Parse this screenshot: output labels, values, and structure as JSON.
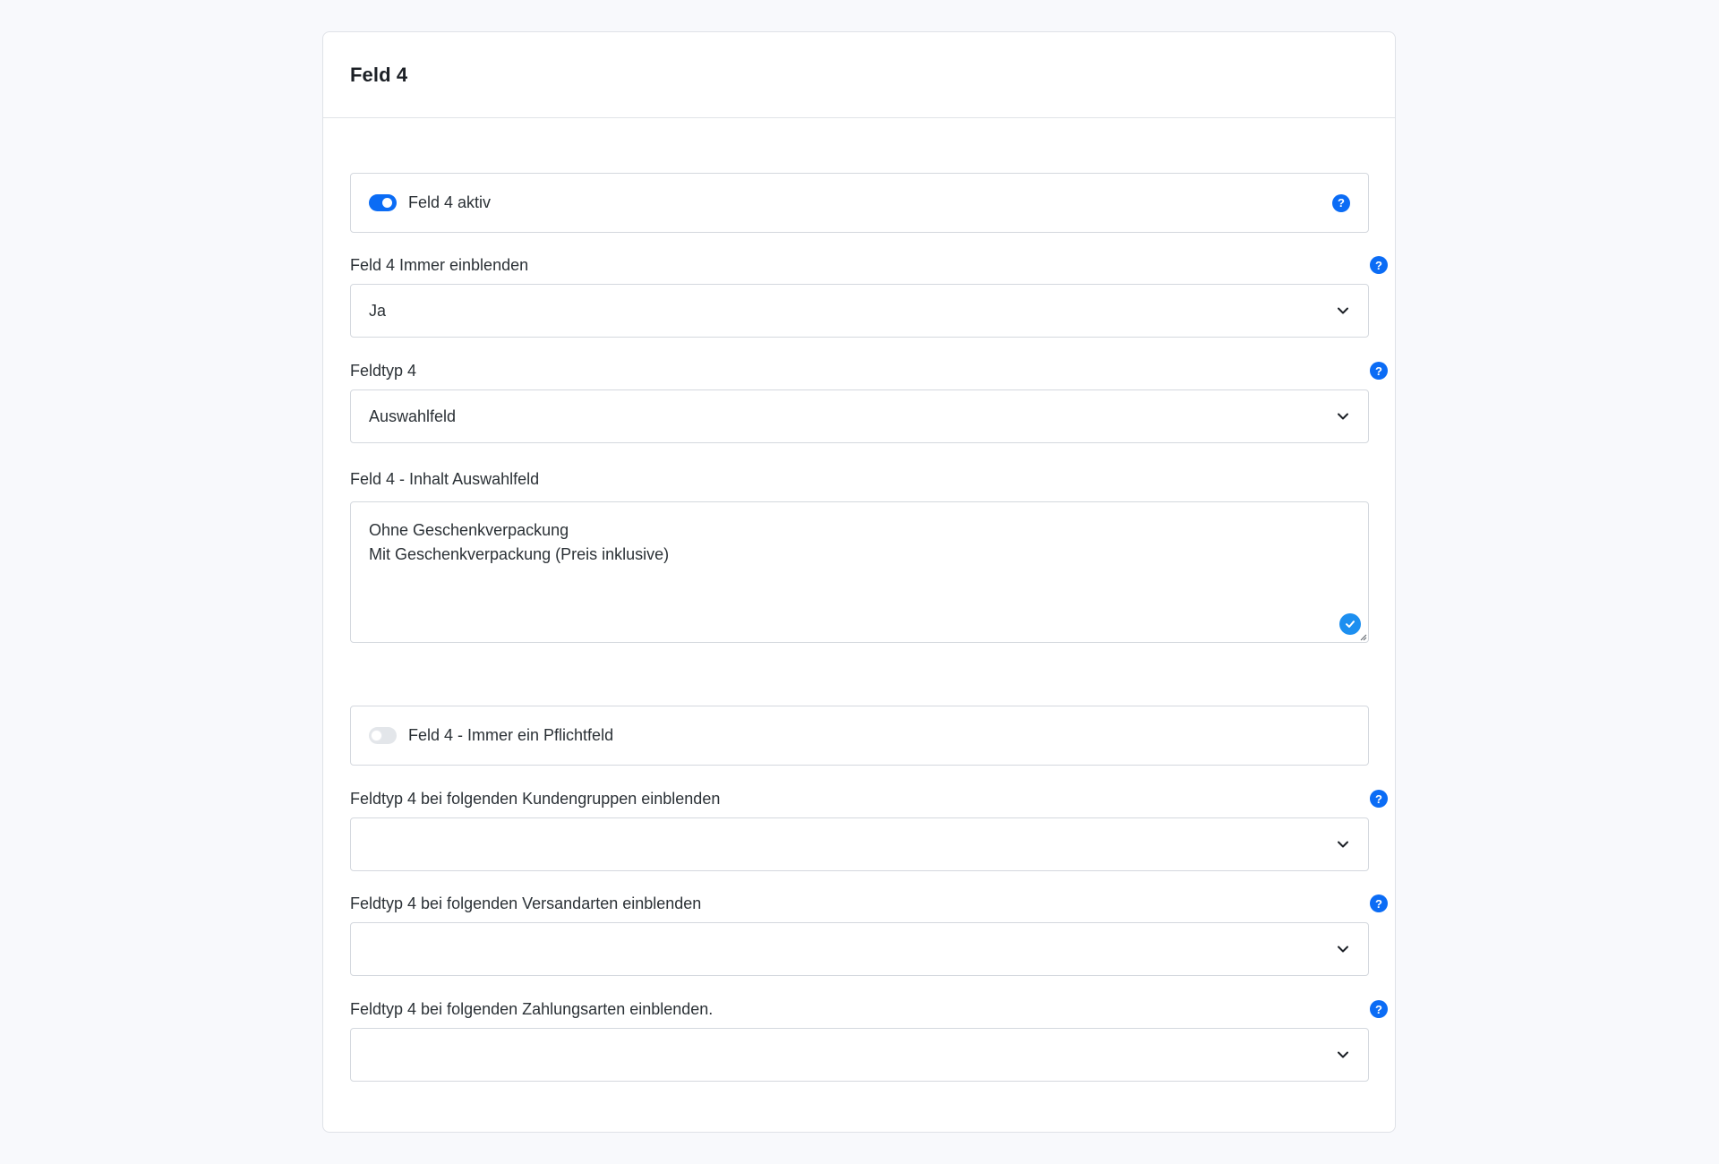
{
  "card": {
    "title": "Feld 4"
  },
  "fields": {
    "active_toggle": {
      "label": "Feld 4 aktiv",
      "checked": true
    },
    "always_show": {
      "label": "Feld 4 Immer einblenden",
      "value": "Ja"
    },
    "field_type": {
      "label": "Feldtyp 4",
      "value": "Auswahlfeld"
    },
    "select_content": {
      "label": "Feld 4 - Inhalt Auswahlfeld",
      "lines": [
        "Ohne Geschenkverpackung",
        "Mit Geschenkverpackung (Preis inklusive)"
      ]
    },
    "required_toggle": {
      "label": "Feld 4 - Immer ein Pflichtfeld",
      "checked": false
    },
    "customer_groups": {
      "label": "Feldtyp 4 bei folgenden Kundengruppen einblenden",
      "value": ""
    },
    "shipping_methods": {
      "label": "Feldtyp 4 bei folgenden Versandarten einblenden",
      "value": ""
    },
    "payment_methods": {
      "label": "Feldtyp 4 bei folgenden Zahlungsarten einblenden.",
      "value": ""
    }
  },
  "icons": {
    "help": "?",
    "dropdown": "chevron-down-icon",
    "valid": "check-icon"
  },
  "colors": {
    "accent": "#0b6cf5",
    "valid_badge": "#1d8ff0",
    "border": "#d4d8de",
    "background": "#f8f9fc"
  }
}
